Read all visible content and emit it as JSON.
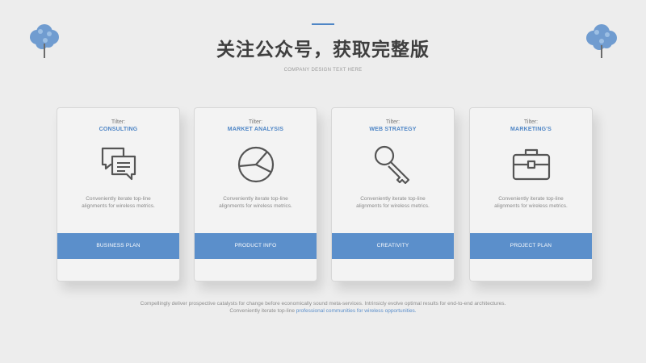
{
  "header": {
    "title": "关注公众号，获取完整版",
    "subtitle": "COMPANY DESIGN TEXT HERE"
  },
  "colors": {
    "accent": "#5b8fcb",
    "background": "#ededed",
    "card": "#f3f3f3",
    "tree": "#5b8fcb"
  },
  "cards": [
    {
      "kicker": "Tilter:",
      "heading": "CONSULTING",
      "icon": "chat-bubbles-icon",
      "description": "Conveniently iterate top-line alignments for wireless metrics.",
      "band_label": "BUSINESS PLAN"
    },
    {
      "kicker": "Tilter:",
      "heading": "MARKET ANALYSIS",
      "icon": "pie-chart-icon",
      "description": "Conveniently iterate top-line alignments for wireless metrics.",
      "band_label": "PRODUCT INFO"
    },
    {
      "kicker": "Tilter:",
      "heading": "WEB STRATEGY",
      "icon": "key-icon",
      "description": "Conveniently iterate top-line alignments for wireless metrics.",
      "band_label": "CREATIVITY"
    },
    {
      "kicker": "Tilter:",
      "heading": "MARKETING'S",
      "icon": "briefcase-icon",
      "description": "Conveniently iterate top-line alignments for wireless metrics.",
      "band_label": "PROJECT PLAN"
    }
  ],
  "footer": {
    "line1": "Compellingly deliver prospective catalysts for change before economically sound meta-services. Intrinsicly evolve optimal results for end-to-end architectures.",
    "line2_start": "Conveniently iterate top-line",
    "line2_accent": "professional communities for wireless opportunities."
  }
}
